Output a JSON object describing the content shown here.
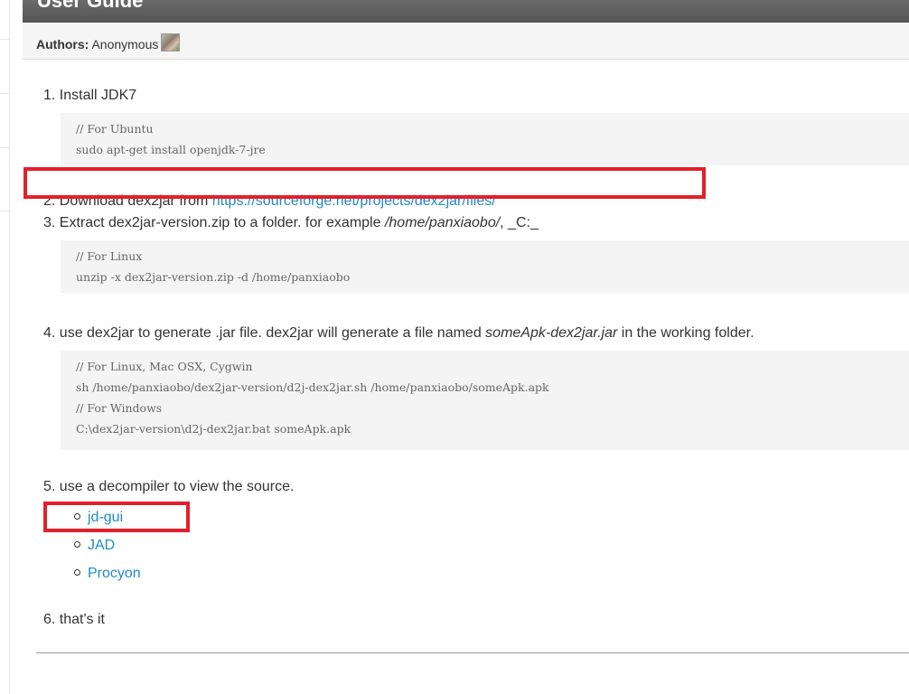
{
  "header": {
    "title": "User Guide"
  },
  "authors": {
    "label": "Authors:",
    "name": "Anonymous"
  },
  "steps": {
    "s1": "1. Install JDK7",
    "s2_prefix": "2. Download dex2jar from ",
    "s2_link": "https://sourceforge.net/projects/dex2jar/files/",
    "s3_prefix": "3. Extract dex2jar-version.zip to a folder. for example ",
    "s3_path": "/home/panxiaobo/",
    "s3_suffix": ", _C:_",
    "s4_prefix": "4. use dex2jar to generate .jar file. dex2jar will generate a file named ",
    "s4_file": "someApk-dex2jar.jar",
    "s4_suffix": " in the working folder.",
    "s5": "5. use a decompiler to view the source.",
    "s6": "6. that's it"
  },
  "code": {
    "c1": [
      "// For Ubuntu",
      "sudo apt-get install openjdk-7-jre"
    ],
    "c3": [
      "// For Linux",
      "unzip -x dex2jar-version.zip -d /home/panxiaobo"
    ],
    "c4": [
      "// For Linux, Mac OSX, Cygwin",
      "sh /home/panxiaobo/dex2jar-version/d2j-dex2jar.sh /home/panxiaobo/someApk.apk",
      "// For Windows",
      "C:\\dex2jar-version\\d2j-dex2jar.bat someApk.apk"
    ]
  },
  "decompilers": [
    "jd-gui",
    "JAD",
    "Procyon"
  ],
  "colors": {
    "link": "#1f8ac9",
    "highlight": "#e3202a",
    "header": "#5f5f5f",
    "code_bg": "#f4f4f4"
  }
}
